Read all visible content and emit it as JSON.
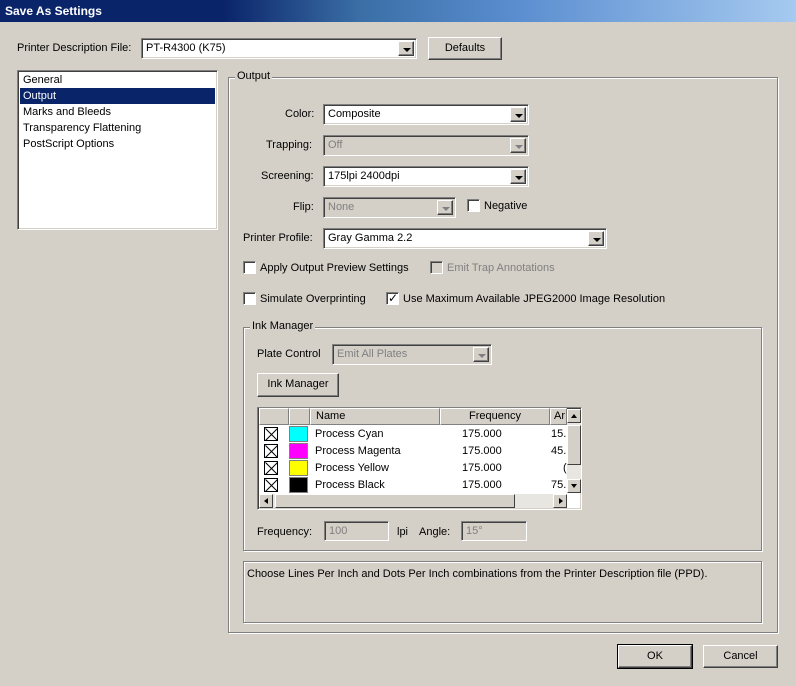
{
  "window": {
    "title": "Save As Settings"
  },
  "ppd": {
    "label_pre": "Printer Description File:",
    "value": "PT-R4300 (K75)",
    "defaults_label": "Defaults"
  },
  "categories": [
    {
      "label": "General",
      "selected": false
    },
    {
      "label": "Output",
      "selected": true
    },
    {
      "label": "Marks and Bleeds",
      "selected": false
    },
    {
      "label": "Transparency Flattening",
      "selected": false
    },
    {
      "label": "PostScript Options",
      "selected": false
    }
  ],
  "output": {
    "legend": "Output",
    "color_label": "Color:",
    "color_value": "Composite",
    "trapping_label": "Trapping:",
    "trapping_value": "Off",
    "screening_label": "Screening:",
    "screening_value": "175lpi 2400dpi",
    "flip_label": "Flip:",
    "flip_value": "None",
    "negative_label": "Negative",
    "printer_profile_label": "Printer Profile:",
    "printer_profile_value": "Gray Gamma 2.2",
    "apply_preview_label": "Apply Output Preview Settings",
    "emit_trap_label": "Emit Trap Annotations",
    "simulate_overprinting_label": "Simulate Overprinting",
    "use_max_jpeg_label": "Use Maximum Available JPEG2000 Image Resolution"
  },
  "ink_manager": {
    "legend": "Ink Manager",
    "plate_control_label": "Plate Control",
    "plate_control_value": "Emit All Plates",
    "button_label": "Ink Manager",
    "columns": {
      "name": "Name",
      "frequency": "Frequency",
      "angle": "Ar"
    },
    "rows": [
      {
        "name": "Process Cyan",
        "frequency": "175.000",
        "angle": "15.",
        "color": "#00ffff"
      },
      {
        "name": "Process Magenta",
        "frequency": "175.000",
        "angle": "45.",
        "color": "#ff00ff"
      },
      {
        "name": "Process Yellow",
        "frequency": "175.000",
        "angle": "(",
        "color": "#ffff00"
      },
      {
        "name": "Process Black",
        "frequency": "175.000",
        "angle": "75.",
        "color": "#000000"
      }
    ],
    "frequency_label": "Frequency:",
    "frequency_value": "100",
    "frequency_unit": "lpi",
    "angle_label": "Angle:",
    "angle_value": "15°"
  },
  "description": "Choose Lines Per Inch and Dots Per Inch combinations from the Printer Description file (PPD).",
  "buttons": {
    "ok": "OK",
    "cancel": "Cancel"
  }
}
